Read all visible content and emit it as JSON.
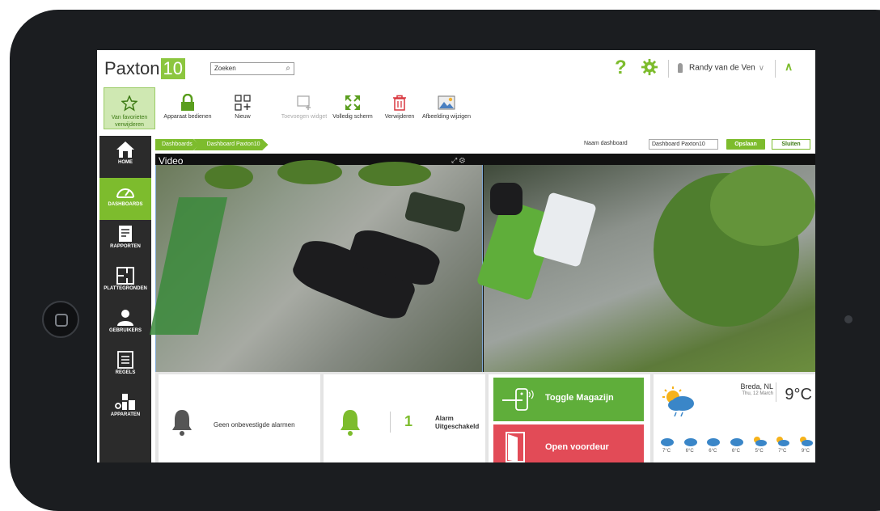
{
  "app": {
    "logo_text": "Paxton",
    "logo_badge": "10"
  },
  "search": {
    "value": "Zoeken"
  },
  "user": {
    "name": "Randy van de Ven"
  },
  "toolbar": {
    "items": [
      {
        "label": "Van favorieten verwijderen",
        "icon": "star-icon"
      },
      {
        "label": "Apparaat bedienen",
        "icon": "lock-icon"
      },
      {
        "label": "Nieuw",
        "icon": "new-grid-icon"
      },
      {
        "label": "Toevoegen widget",
        "icon": "add-widget-icon"
      },
      {
        "label": "Volledig scherm",
        "icon": "fullscreen-icon"
      },
      {
        "label": "Verwijderen",
        "icon": "trash-icon"
      },
      {
        "label": "Afbeelding wijzigen",
        "icon": "image-icon"
      }
    ]
  },
  "breadcrumb": {
    "items": [
      "Dashboards",
      "Dashboard Paxton10"
    ]
  },
  "dashboard_name": {
    "label": "Naam dashboard",
    "value": "Dashboard Paxton10",
    "save_label": "Opslaan",
    "close_label": "Sluiten"
  },
  "sidebar": {
    "items": [
      {
        "label": "HOME",
        "icon": "home-icon"
      },
      {
        "label": "DASHBOARDS",
        "icon": "gauge-icon",
        "active": true
      },
      {
        "label": "RAPPORTEN",
        "icon": "report-icon"
      },
      {
        "label": "PLATTEGRONDEN",
        "icon": "floorplan-icon"
      },
      {
        "label": "GEBRUIKERS",
        "icon": "user-icon"
      },
      {
        "label": "REGELS",
        "icon": "rules-icon"
      },
      {
        "label": "APPARATEN",
        "icon": "devices-icon"
      }
    ]
  },
  "video": {
    "title": "Video"
  },
  "widgets": {
    "alarms": {
      "text": "Geen onbevestigde alarmen"
    },
    "alarm_status": {
      "count": "1",
      "line1": "Alarm",
      "line2": "Uitgeschakeld"
    },
    "access": {
      "toggle_label": "Toggle Magazijn",
      "open_label": "Open voordeur"
    },
    "weather": {
      "city": "Breda, NL",
      "date": "Thu, 12 March",
      "temp": "9°C",
      "forecast": [
        "7°C",
        "6°C",
        "6°C",
        "6°C",
        "5°C",
        "7°C",
        "9°C"
      ]
    }
  },
  "colors": {
    "accent": "#7dbc2d",
    "sidebar_bg": "#2b2b2b",
    "toggle_bg": "#5fae3a",
    "open_bg": "#e24b57"
  }
}
